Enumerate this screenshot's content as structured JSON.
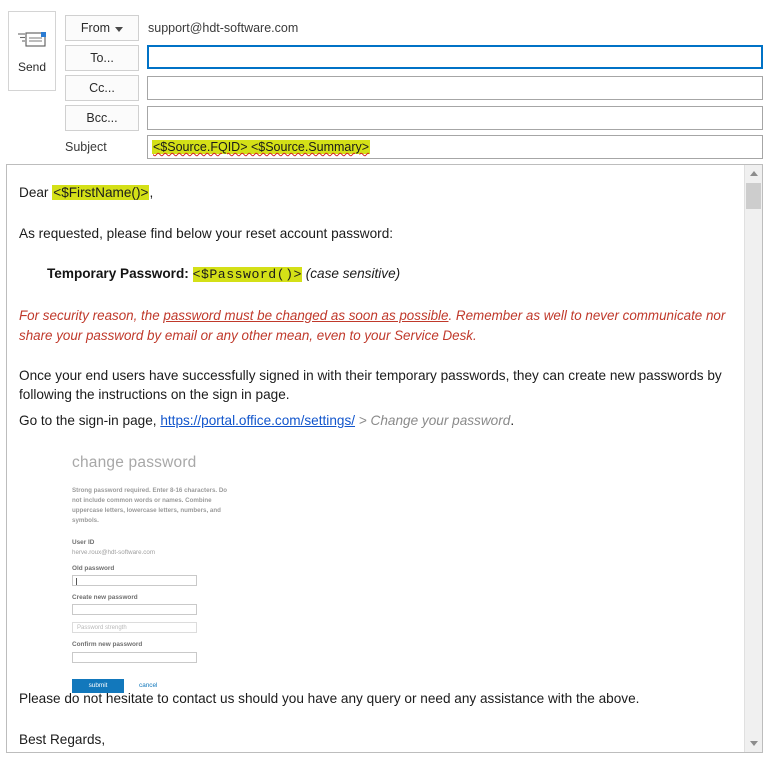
{
  "compose": {
    "send_label": "Send",
    "send_icon": "envelope-send-icon",
    "from_label": "From",
    "from_value": "support@hdt-software.com",
    "to_label": "To...",
    "to_value": "",
    "cc_label": "Cc...",
    "cc_value": "",
    "bcc_label": "Bcc...",
    "bcc_value": "",
    "subject_label": "Subject",
    "subject_value": "<$Source.FQID> <$Source.Summary>",
    "focused_field": "to",
    "highlight_color": "#d4e017",
    "focus_border_color": "#0072c6"
  },
  "body": {
    "greeting_prefix": "Dear ",
    "greeting_token": "<$FirstName()>",
    "greeting_suffix": ",",
    "intro": "As requested, please find below your reset account password:",
    "password_label": "Temporary Password:",
    "password_token": "<$Password()>",
    "password_note": "(case sensitive)",
    "warning_lead": "For security reason, the ",
    "warning_underlined": "password must be changed as soon as possible",
    "warning_tail": ". Remember as well to never communicate nor share your password by email or any other mean, even to your Service Desk.",
    "instructions": "Once your end users have successfully signed in with their temporary passwords, they can create new passwords by following the instructions on the sign in page.",
    "goto_prefix": "Go to the sign-in page, ",
    "goto_link": "https://portal.office.com/settings/",
    "goto_separator": " > ",
    "goto_breadcrumb": "Change your password",
    "goto_period": ".",
    "closing": "Please do not hesitate to contact us should you have any query or need any assistance with the above.",
    "regards": "Best Regards,"
  },
  "embedded_screenshot": {
    "title": "change password",
    "help_text": "Strong password required. Enter 8-16 characters. Do not include common words or names. Combine uppercase letters, lowercase letters, numbers, and symbols.",
    "user_id_label": "User ID",
    "user_id_value": "herve.roux@hdt-software.com",
    "old_password_label": "Old password",
    "old_password_value": "",
    "create_password_label": "Create new password",
    "create_password_value": "",
    "strength_placeholder": "Password strength",
    "confirm_password_label": "Confirm new password",
    "confirm_password_value": "",
    "submit_label": "submit",
    "cancel_label": "cancel",
    "accent_color": "#1278bc"
  },
  "scrollbar": {
    "up_icon": "chevron-up-icon",
    "down_icon": "chevron-down-icon"
  }
}
